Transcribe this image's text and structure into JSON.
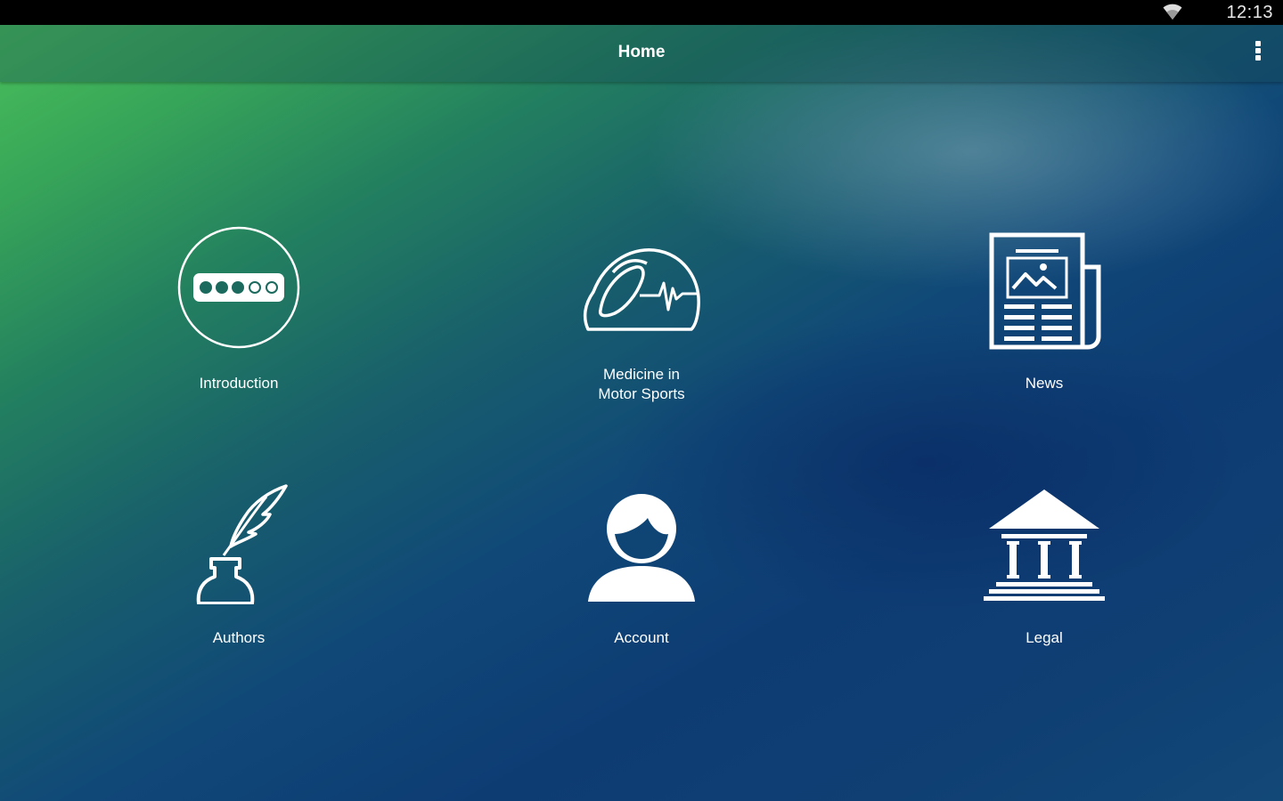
{
  "status_bar": {
    "time": "12:13",
    "wifi_icon": "wifi-icon"
  },
  "app_bar": {
    "title": "Home",
    "menu_icon": "overflow-menu-icon"
  },
  "tiles": [
    {
      "label": "Introduction",
      "icon": "progress-dots-circle-icon"
    },
    {
      "label": "Medicine in\nMotor Sports",
      "icon": "racing-helmet-heartbeat-icon"
    },
    {
      "label": "News",
      "icon": "newspaper-icon"
    },
    {
      "label": "Authors",
      "icon": "quill-inkwell-icon"
    },
    {
      "label": "Account",
      "icon": "user-profile-icon"
    },
    {
      "label": "Legal",
      "icon": "courthouse-icon"
    }
  ],
  "colors": {
    "status_bar": "#000000",
    "gradient_top_left": "#4cc25a",
    "gradient_bottom_right": "#0d3c73",
    "icon_color": "#ffffff"
  }
}
